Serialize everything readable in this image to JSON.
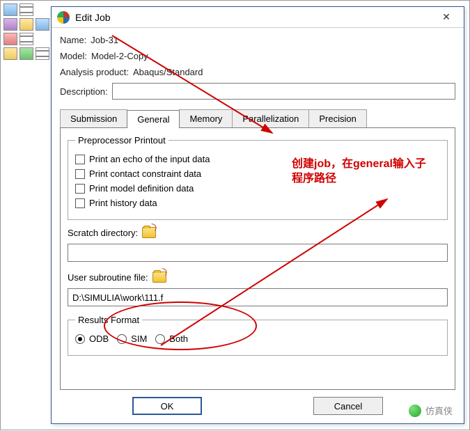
{
  "dialog": {
    "title": "Edit Job",
    "name_label": "Name:",
    "name_value": "Job-31",
    "model_label": "Model:",
    "model_value": "Model-2-Copy",
    "analysis_label": "Analysis product:",
    "analysis_value": "Abaqus/Standard",
    "description_label": "Description:",
    "description_value": ""
  },
  "tabs": [
    "Submission",
    "General",
    "Memory",
    "Parallelization",
    "Precision"
  ],
  "active_tab": "General",
  "preprocessor": {
    "legend": "Preprocessor Printout",
    "opts": [
      "Print an echo of the input data",
      "Print contact constraint data",
      "Print model definition data",
      "Print history data"
    ]
  },
  "scratch_label": "Scratch directory:",
  "scratch_value": "",
  "usr_label": "User subroutine file:",
  "usr_value": "D:\\SIMULIA\\work\\111.f",
  "results": {
    "legend": "Results Format",
    "options": [
      "ODB",
      "SIM",
      "Both"
    ],
    "selected": "ODB"
  },
  "buttons": {
    "ok": "OK",
    "cancel": "Cancel"
  },
  "annotation_line1": "创建job，在general输入子",
  "annotation_line2": "程序路径",
  "watermark": "仿真侠"
}
